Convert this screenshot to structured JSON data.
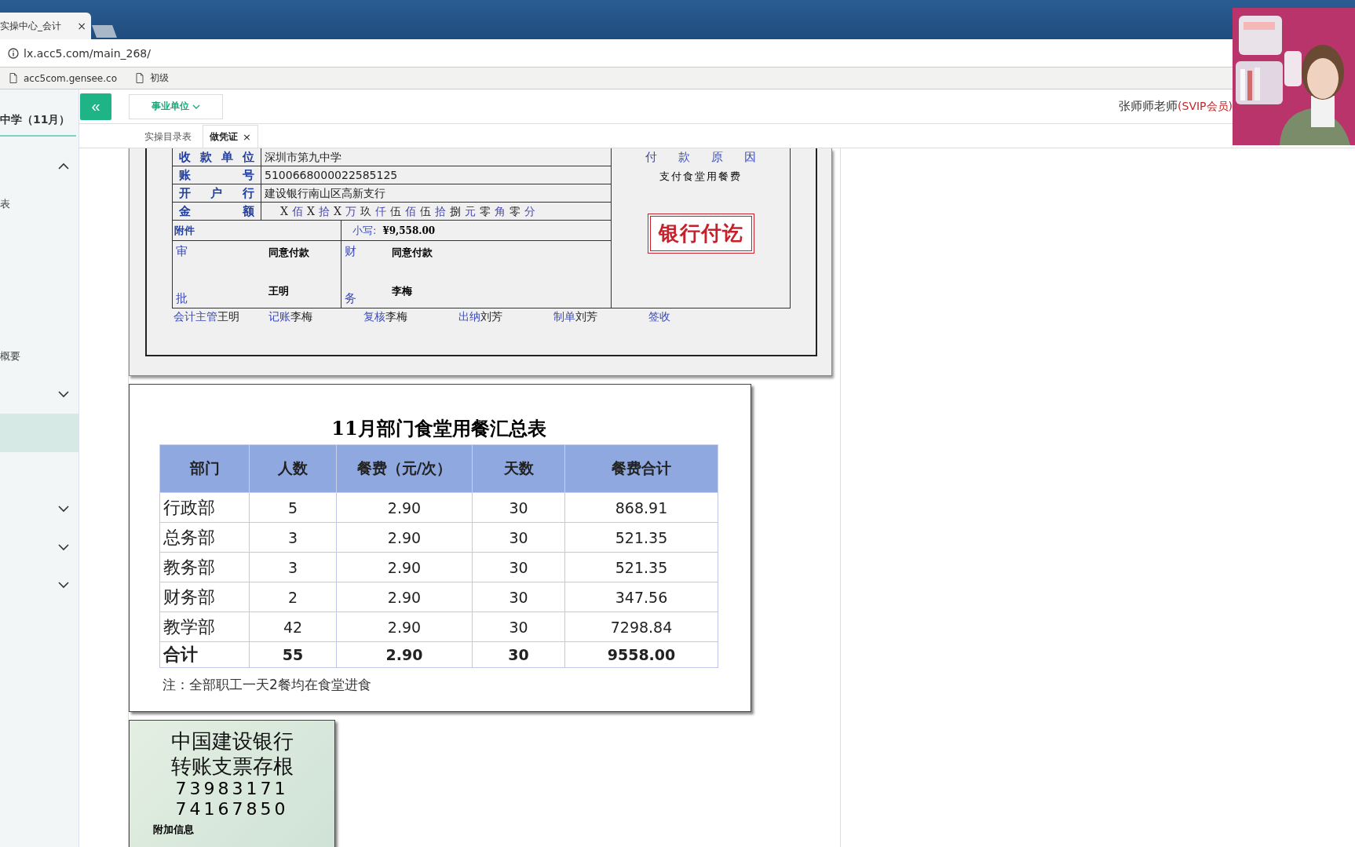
{
  "browser": {
    "tab_title": "实操中心_会计",
    "tab_close": "×",
    "address": "lx.acc5.com/main_268/",
    "bookmarks": [
      "acc5com.gensee.co",
      "初级"
    ]
  },
  "app": {
    "collapse_button": "«",
    "unit_dropdown": "事业单位",
    "user_name": "张师师老师",
    "member_badge": "(SVIP会员)",
    "tabs": [
      {
        "label": "实操目录表",
        "selected": false,
        "closable": false
      },
      {
        "label": "做凭证",
        "selected": true,
        "closable": true
      }
    ],
    "tab_close": "×"
  },
  "sidebar": {
    "title": "中学（11月）",
    "items": [
      {
        "kind": "group",
        "expanded": true
      },
      {
        "kind": "item",
        "label": "表",
        "selected": false
      },
      {
        "kind": "blank",
        "selected": false
      },
      {
        "kind": "blank",
        "selected": false
      },
      {
        "kind": "blank",
        "selected": false
      },
      {
        "kind": "item",
        "label": "概要",
        "selected": false
      },
      {
        "kind": "group",
        "expanded": false
      },
      {
        "kind": "blank",
        "selected": true
      },
      {
        "kind": "blank",
        "selected": false
      },
      {
        "kind": "group",
        "expanded": false
      },
      {
        "kind": "group",
        "expanded": false
      },
      {
        "kind": "group",
        "expanded": false
      }
    ]
  },
  "voucher": {
    "payee_rows": [
      {
        "label": "收 款 单 位",
        "value": "深圳市第九中学"
      },
      {
        "label": "账 号",
        "value": "5100668000022585125"
      },
      {
        "label": "开 户 行",
        "value": "建设银行南山区高新支行"
      }
    ],
    "amount": {
      "label": "金 额",
      "chars": [
        {
          "text": "X",
          "kind": "digit"
        },
        {
          "text": "佰",
          "kind": "unit"
        },
        {
          "text": "X",
          "kind": "digit"
        },
        {
          "text": "拾",
          "kind": "unit"
        },
        {
          "text": "X",
          "kind": "digit"
        },
        {
          "text": "万",
          "kind": "unit"
        },
        {
          "text": "玖",
          "kind": "digit"
        },
        {
          "text": "仟",
          "kind": "unit"
        },
        {
          "text": "伍",
          "kind": "digit"
        },
        {
          "text": "佰",
          "kind": "unit"
        },
        {
          "text": "伍",
          "kind": "digit"
        },
        {
          "text": "拾",
          "kind": "unit"
        },
        {
          "text": "捌",
          "kind": "digit"
        },
        {
          "text": "元",
          "kind": "unit"
        },
        {
          "text": "零",
          "kind": "digit"
        },
        {
          "text": "角",
          "kind": "unit"
        },
        {
          "text": "零",
          "kind": "digit"
        },
        {
          "text": "分",
          "kind": "unit"
        }
      ]
    },
    "attachment_label": "附件",
    "small_label": "小写:",
    "small_amount": "¥9,558.00",
    "sign_boxes": [
      {
        "label_top": "审",
        "label_bottom": "批",
        "opinion": "同意付款",
        "signer": "王明"
      },
      {
        "label_top": "财",
        "label_bottom": "务",
        "opinion": "同意付款",
        "signer": "李梅"
      }
    ],
    "reason_label": "付 款 原 因",
    "reason": "支付食堂用餐费",
    "stamp": "银行付讫",
    "signatures": [
      {
        "role": "会计主管",
        "name": "王明"
      },
      {
        "role": "记账",
        "name": "李梅"
      },
      {
        "role": "复核",
        "name": "李梅"
      },
      {
        "role": "出纳",
        "name": "刘芳"
      },
      {
        "role": "制单",
        "name": "刘芳"
      },
      {
        "role": "签收"
      }
    ]
  },
  "summary": {
    "title": "11月部门食堂用餐汇总表",
    "columns": [
      "部门",
      "人数",
      "餐费（元/次）",
      "天数",
      "餐费合计"
    ],
    "rows": [
      {
        "kind": "row",
        "cells": [
          "行政部",
          "5",
          "2.90",
          "30",
          "868.91"
        ]
      },
      {
        "kind": "row",
        "cells": [
          "总务部",
          "3",
          "2.90",
          "30",
          "521.35"
        ]
      },
      {
        "kind": "row",
        "cells": [
          "教务部",
          "3",
          "2.90",
          "30",
          "521.35"
        ]
      },
      {
        "kind": "row",
        "cells": [
          "财务部",
          "2",
          "2.90",
          "30",
          "347.56"
        ]
      },
      {
        "kind": "row",
        "cells": [
          "教学部",
          "42",
          "2.90",
          "30",
          "7298.84"
        ]
      },
      {
        "kind": "total",
        "cells": [
          "合计",
          "55",
          "2.90",
          "30",
          "9558.00"
        ]
      }
    ],
    "note": "注：全部职工一天2餐均在食堂进食"
  },
  "check_stub": {
    "bank": "中国建设银行",
    "title": "转账支票存根",
    "numbers": [
      "73983171",
      "74167850"
    ],
    "extra_label": "附加信息"
  }
}
